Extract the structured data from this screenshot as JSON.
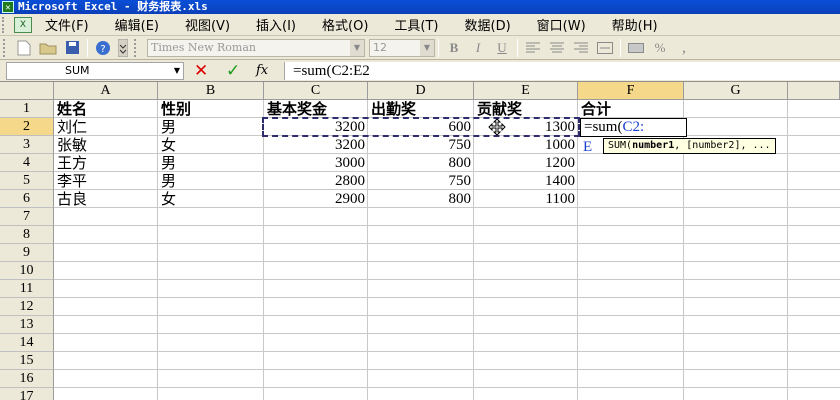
{
  "window": {
    "title": "Microsoft Excel - 财务报表.xls",
    "app_icon": "excel-icon"
  },
  "menu": [
    "文件(F)",
    "编辑(E)",
    "视图(V)",
    "插入(I)",
    "格式(O)",
    "工具(T)",
    "数据(D)",
    "窗口(W)",
    "帮助(H)"
  ],
  "toolbar": {
    "font": "Times New Roman",
    "size": "12",
    "bold": "B",
    "italic": "I",
    "underline": "U",
    "percent": "%"
  },
  "formula_bar": {
    "name_box": "SUM",
    "cancel": "✕",
    "enter": "✓",
    "fx": "fx",
    "content": "=sum(C2:E2"
  },
  "sheet": {
    "columns": [
      "A",
      "B",
      "C",
      "D",
      "E",
      "F",
      "G"
    ],
    "active_column": "F",
    "rows": [
      "1",
      "2",
      "3",
      "4",
      "5",
      "6",
      "7",
      "8",
      "9",
      "10",
      "11",
      "12",
      "13",
      "14",
      "15",
      "16",
      "17"
    ],
    "active_row": "2",
    "header": [
      "姓名",
      "性别",
      "基本奖金",
      "出勤奖",
      "贡献奖",
      "合计"
    ],
    "data": [
      {
        "name": "刘仁",
        "gender": "男",
        "basic": "3200",
        "attendance": "600",
        "contribution": "1300"
      },
      {
        "name": "张敏",
        "gender": "女",
        "basic": "3200",
        "attendance": "750",
        "contribution": "1000"
      },
      {
        "name": "王方",
        "gender": "男",
        "basic": "3000",
        "attendance": "800",
        "contribution": "1200"
      },
      {
        "name": "李平",
        "gender": "男",
        "basic": "2800",
        "attendance": "750",
        "contribution": "1400"
      },
      {
        "name": "古良",
        "gender": "女",
        "basic": "2900",
        "attendance": "800",
        "contribution": "1100"
      }
    ],
    "editing_cell": {
      "prefix": "=sum(",
      "ref": "C2:"
    },
    "stray_char": "E",
    "tooltip": {
      "func": "SUM(",
      "arg1": "number1",
      "rest": ", [number2], ..."
    }
  }
}
